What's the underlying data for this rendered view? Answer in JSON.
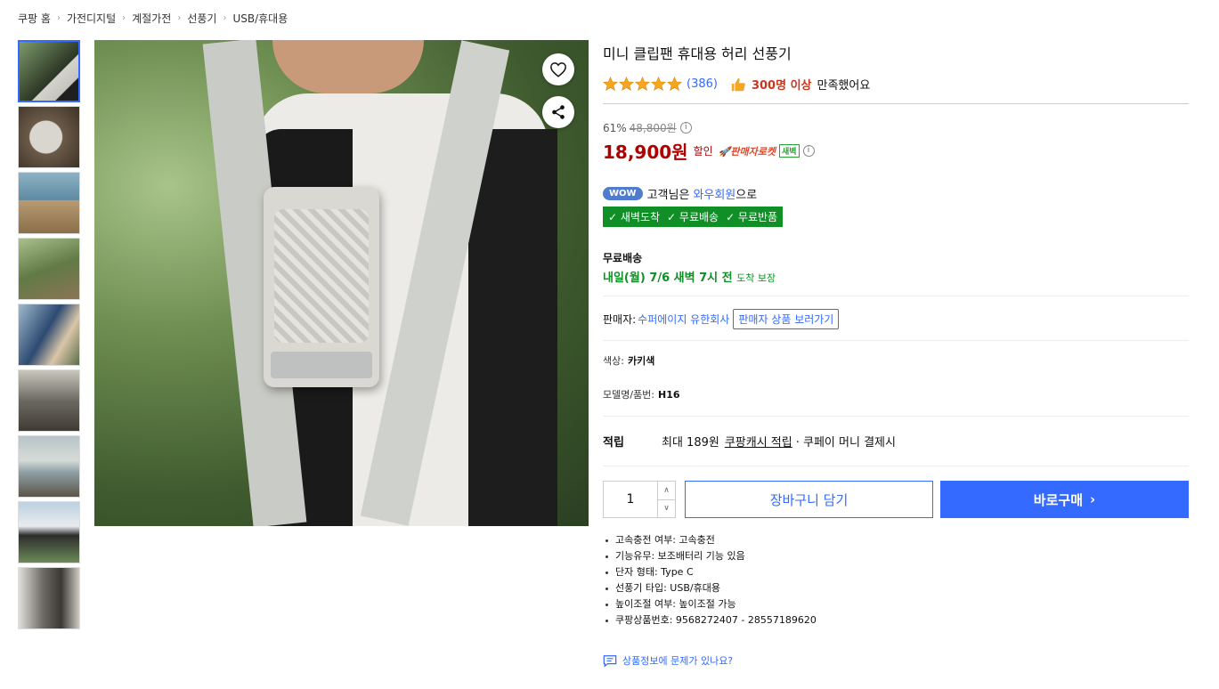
{
  "breadcrumb": [
    "쿠팡 홈",
    "가전디지털",
    "계절가전",
    "선풍기",
    "USB/휴대용"
  ],
  "product": {
    "title": "미니 클립팬 휴대용 허리 선풍기",
    "rating_stars": 5,
    "review_count": "(386)",
    "satisfaction_strong": "300명 이상",
    "satisfaction_text": "만족했어요"
  },
  "price": {
    "discount_rate": "61%",
    "original_price": "48,800원",
    "sale_price": "18,900원",
    "sale_label": "할인",
    "rocket_label": "🚀판매자로켓",
    "dawn_badge": "새벽"
  },
  "wow": {
    "badge": "WOW",
    "text_prefix": "고객님은",
    "member_link": "와우회원",
    "text_suffix": "으로",
    "benefits": [
      "✓ 새벽도착",
      "✓ 무료배송",
      "✓ 무료반품"
    ]
  },
  "shipping": {
    "label": "무료배송",
    "date": "내일(월) 7/6 새벽 7시 전",
    "guarantee": "도착 보장"
  },
  "seller": {
    "label": "판매자:",
    "name": "수퍼에이지 유한회사",
    "button": "판매자 상품 보러가기"
  },
  "options": {
    "color_label": "색상:",
    "color_value": "카키색",
    "model_label": "모델명/품번:",
    "model_value": "H16"
  },
  "reward": {
    "label": "적립",
    "amount": "최대 189원",
    "link": "쿠팡캐시 적립",
    "suffix": "· 쿠페이 머니 결제시"
  },
  "purchase": {
    "quantity": "1",
    "cart_button": "장바구니 담기",
    "buy_button": "바로구매"
  },
  "specs": [
    "고속충전 여부: 고속충전",
    "기능유무: 보조배터리 기능 있음",
    "단자 형태: Type C",
    "선풍기 타입: USB/휴대용",
    "높이조절 여부: 높이조절 가능",
    "쿠팡상품번호: 9568272407 - 28557189620"
  ],
  "report_link": "상품정보에 문제가 있나요?",
  "colors": {
    "accent": "#346aff",
    "price_red": "#ae0000",
    "rocket_green": "#0f8f26",
    "satisfy_orange": "#c7381d",
    "star": "#f5a623"
  }
}
